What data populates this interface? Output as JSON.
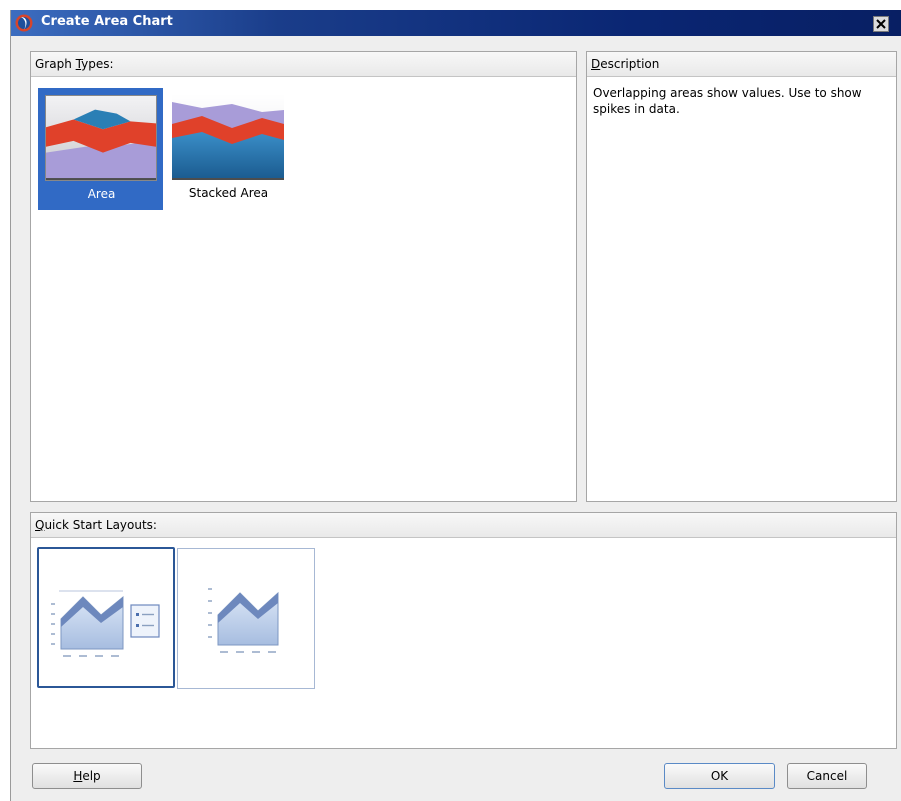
{
  "window": {
    "title": "Create  Area Chart",
    "close_glyph": "✕"
  },
  "graph_types": {
    "header": {
      "pre": "Graph ",
      "mnemonic": "T",
      "post": "ypes:"
    },
    "items": [
      {
        "label": "Area",
        "selected": true,
        "icon": "area-chart-icon"
      },
      {
        "label": "Stacked Area",
        "selected": false,
        "icon": "stacked-area-chart-icon"
      }
    ]
  },
  "description": {
    "header": {
      "pre": "",
      "mnemonic": "D",
      "post": "escription"
    },
    "text": "Overlapping areas show values. Use to show spikes in data."
  },
  "quick_start": {
    "header": {
      "pre": "",
      "mnemonic": "Q",
      "post": "uick Start Layouts:"
    },
    "layouts": [
      {
        "name": "chart-with-legend",
        "selected": true,
        "icon": "area-layout-with-legend-icon"
      },
      {
        "name": "chart-only",
        "selected": false,
        "icon": "area-layout-icon"
      }
    ]
  },
  "buttons": {
    "help": {
      "mnemonic": "H",
      "rest": "elp"
    },
    "ok": "OK",
    "cancel": "Cancel"
  },
  "colors": {
    "selection": "#316ac5",
    "title_bar": "#0a2673",
    "area_red": "#e0412a",
    "area_blue": "#2a7fb5",
    "area_purple": "#a89cd8"
  }
}
